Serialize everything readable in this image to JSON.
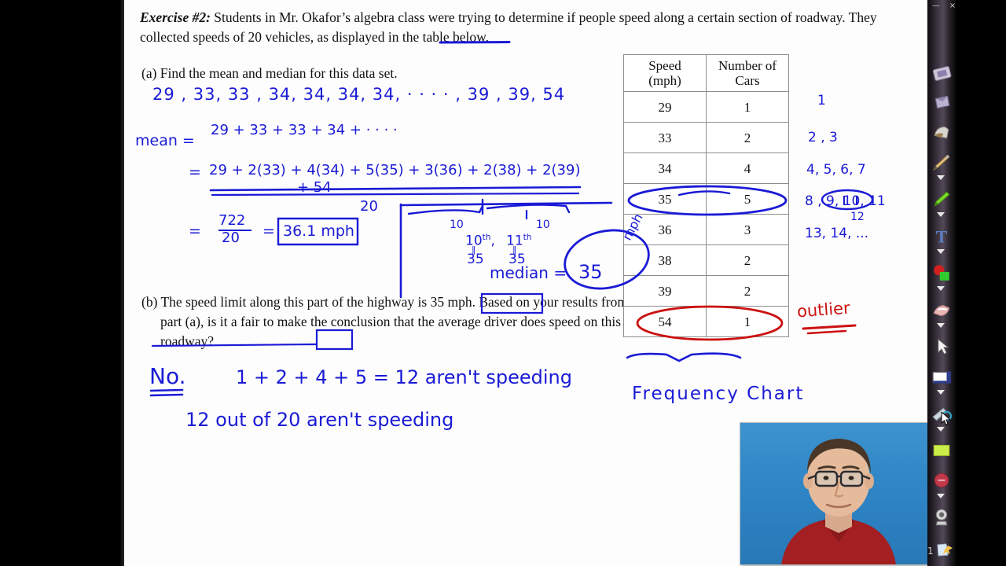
{
  "app": {
    "window_controls": {
      "minimize": "—",
      "close": "×"
    },
    "page_indicator": "1"
  },
  "worksheet": {
    "exercise_label": "Exercise #2:",
    "stem_part1": " Students in Mr. Okafor’s algebra class were trying to determine if people speed along a certain section of roadway.  They collected speeds of ",
    "stem_highlight": "20",
    "stem_part2": " vehicles, as displayed in the table below.",
    "part_a": "(a) Find the mean and median for this data set.",
    "part_b_line1_pre": "(b) The speed limit along this part of the highway is ",
    "part_b_boxed": "35 mph",
    "part_b_line1_post": ".  Based on",
    "part_b_line2": "your results from part (a), is it a fair to make the conclusion that the",
    "part_b_line3_pre": "average driver",
    "part_b_line3_boxed": "does",
    "part_b_line3_post": " speed on this roadway?"
  },
  "chart_data": {
    "type": "table",
    "title": "Frequency Chart",
    "headers": [
      "Speed\n(mph)",
      "Number of\nCars"
    ],
    "header_line1": [
      "Speed",
      "Number of"
    ],
    "header_line2": [
      "(mph)",
      "Cars"
    ],
    "categories": [
      "29",
      "33",
      "34",
      "35",
      "36",
      "38",
      "39",
      "54"
    ],
    "values": [
      1,
      2,
      4,
      5,
      3,
      2,
      2,
      1
    ],
    "rows": [
      {
        "speed": "29",
        "cars": "1"
      },
      {
        "speed": "33",
        "cars": "2"
      },
      {
        "speed": "34",
        "cars": "4"
      },
      {
        "speed": "35",
        "cars": "5"
      },
      {
        "speed": "36",
        "cars": "3"
      },
      {
        "speed": "38",
        "cars": "2"
      },
      {
        "speed": "39",
        "cars": "2"
      },
      {
        "speed": "54",
        "cars": "1"
      }
    ],
    "xlabel": "Speed (mph)",
    "ylabel": "Number of Cars",
    "total": 20,
    "annotations": {
      "circled_rows": [
        "35",
        "54"
      ],
      "outlier_label": "outlier",
      "chart_label": "Frequency Chart"
    }
  },
  "annotations": {
    "data_list": "29 , 33, 33 , 34, 34, 34, 34, · · · ·  ,  39 , 39, 54",
    "mean_label": "mean =",
    "mean_line1": "29 + 33  +  33  +  34 + · · · ·",
    "mean_eq1": "=",
    "mean_line2": "29 + 2(33) + 4(34) + 5(35) + 3(36) + 2(38) + 2(39)",
    "mean_line2b": "+ 54",
    "denominator": "20",
    "mean_eq2": "=",
    "fraction_num": "722",
    "fraction_den": "20",
    "mean_eq3": "=",
    "mean_boxed": "36.1 mph",
    "median_left_count": "10",
    "median_right_count": "10",
    "median_pos_10": "10",
    "median_pos_10_sup": "th",
    "median_pos_comma": ",",
    "median_pos_11": "11",
    "median_pos_11_sup": "th",
    "median_eq_sign_left": "‖",
    "median_val_left": "35",
    "median_eq_sign_right": "‖",
    "median_val_right": "35",
    "median_label": "median =",
    "median_answer": "35",
    "median_units": "mph",
    "position_index": [
      "1",
      "2 , 3",
      "4, 5, 6, 7",
      "8 , 9,",
      "10, 11",
      "12",
      "13, 14, ..."
    ],
    "pos_row1": "1",
    "pos_row2": "2 , 3",
    "pos_row3": "4, 5, 6, 7",
    "pos_row4_pre": "8 , 9,",
    "pos_row4_circled": "10, 11",
    "pos_row5": "12",
    "pos_row6": "13, 14, ...",
    "outlier": "outlier",
    "frequency_chart": "Frequency Chart",
    "answer_no": "No.",
    "answer_line1": "1 + 2 + 4 + 5  =  12  aren't  speeding",
    "answer_line2": "12  out  of   20   aren't   speeding"
  },
  "toolbar": {
    "items": [
      {
        "name": "capture-icon",
        "caret": false
      },
      {
        "name": "shapes-icon",
        "caret": false
      },
      {
        "name": "page-curl-icon",
        "caret": false
      },
      {
        "name": "pen-icon",
        "caret": true
      },
      {
        "name": "highlighter-icon",
        "caret": true
      },
      {
        "name": "text-tool-icon",
        "caret": true
      },
      {
        "name": "color-swatch-icon",
        "caret": true
      },
      {
        "name": "eraser-icon",
        "caret": true
      },
      {
        "name": "select-arrow-icon",
        "caret": false
      },
      {
        "name": "screen-shade-icon",
        "caret": true
      },
      {
        "name": "spotlight-icon",
        "caret": true
      },
      {
        "name": "fill-color-icon",
        "caret": false
      },
      {
        "name": "record-icon",
        "caret": true
      },
      {
        "name": "camera-icon",
        "caret": false
      },
      {
        "name": "page-sort-icon",
        "caret": false
      }
    ]
  },
  "colors": {
    "ink_blue": "#1a1ad6",
    "ink_red": "#cc1111",
    "page_white": "#fdfdfd",
    "video_blue": "#2f86c5",
    "shirt_red": "#a31f22"
  }
}
